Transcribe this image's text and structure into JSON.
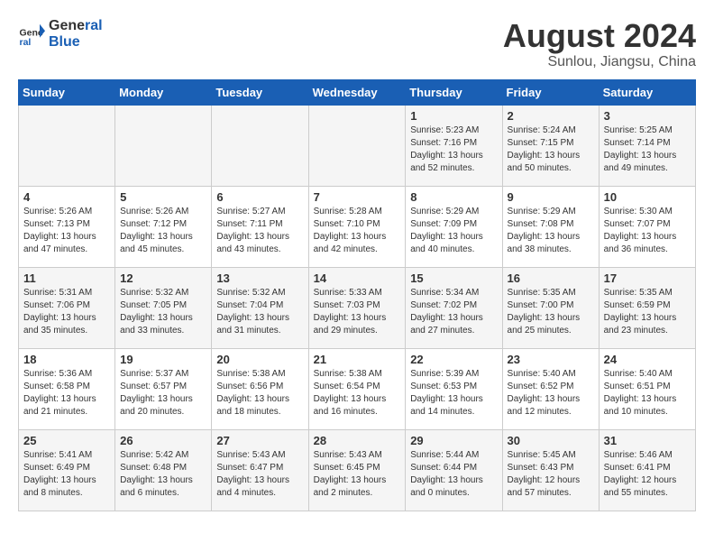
{
  "header": {
    "logo_line1": "General",
    "logo_line2": "Blue",
    "title": "August 2024",
    "subtitle": "Sunlou, Jiangsu, China"
  },
  "days_of_week": [
    "Sunday",
    "Monday",
    "Tuesday",
    "Wednesday",
    "Thursday",
    "Friday",
    "Saturday"
  ],
  "weeks": [
    [
      {
        "day": "",
        "info": ""
      },
      {
        "day": "",
        "info": ""
      },
      {
        "day": "",
        "info": ""
      },
      {
        "day": "",
        "info": ""
      },
      {
        "day": "1",
        "info": "Sunrise: 5:23 AM\nSunset: 7:16 PM\nDaylight: 13 hours\nand 52 minutes."
      },
      {
        "day": "2",
        "info": "Sunrise: 5:24 AM\nSunset: 7:15 PM\nDaylight: 13 hours\nand 50 minutes."
      },
      {
        "day": "3",
        "info": "Sunrise: 5:25 AM\nSunset: 7:14 PM\nDaylight: 13 hours\nand 49 minutes."
      }
    ],
    [
      {
        "day": "4",
        "info": "Sunrise: 5:26 AM\nSunset: 7:13 PM\nDaylight: 13 hours\nand 47 minutes."
      },
      {
        "day": "5",
        "info": "Sunrise: 5:26 AM\nSunset: 7:12 PM\nDaylight: 13 hours\nand 45 minutes."
      },
      {
        "day": "6",
        "info": "Sunrise: 5:27 AM\nSunset: 7:11 PM\nDaylight: 13 hours\nand 43 minutes."
      },
      {
        "day": "7",
        "info": "Sunrise: 5:28 AM\nSunset: 7:10 PM\nDaylight: 13 hours\nand 42 minutes."
      },
      {
        "day": "8",
        "info": "Sunrise: 5:29 AM\nSunset: 7:09 PM\nDaylight: 13 hours\nand 40 minutes."
      },
      {
        "day": "9",
        "info": "Sunrise: 5:29 AM\nSunset: 7:08 PM\nDaylight: 13 hours\nand 38 minutes."
      },
      {
        "day": "10",
        "info": "Sunrise: 5:30 AM\nSunset: 7:07 PM\nDaylight: 13 hours\nand 36 minutes."
      }
    ],
    [
      {
        "day": "11",
        "info": "Sunrise: 5:31 AM\nSunset: 7:06 PM\nDaylight: 13 hours\nand 35 minutes."
      },
      {
        "day": "12",
        "info": "Sunrise: 5:32 AM\nSunset: 7:05 PM\nDaylight: 13 hours\nand 33 minutes."
      },
      {
        "day": "13",
        "info": "Sunrise: 5:32 AM\nSunset: 7:04 PM\nDaylight: 13 hours\nand 31 minutes."
      },
      {
        "day": "14",
        "info": "Sunrise: 5:33 AM\nSunset: 7:03 PM\nDaylight: 13 hours\nand 29 minutes."
      },
      {
        "day": "15",
        "info": "Sunrise: 5:34 AM\nSunset: 7:02 PM\nDaylight: 13 hours\nand 27 minutes."
      },
      {
        "day": "16",
        "info": "Sunrise: 5:35 AM\nSunset: 7:00 PM\nDaylight: 13 hours\nand 25 minutes."
      },
      {
        "day": "17",
        "info": "Sunrise: 5:35 AM\nSunset: 6:59 PM\nDaylight: 13 hours\nand 23 minutes."
      }
    ],
    [
      {
        "day": "18",
        "info": "Sunrise: 5:36 AM\nSunset: 6:58 PM\nDaylight: 13 hours\nand 21 minutes."
      },
      {
        "day": "19",
        "info": "Sunrise: 5:37 AM\nSunset: 6:57 PM\nDaylight: 13 hours\nand 20 minutes."
      },
      {
        "day": "20",
        "info": "Sunrise: 5:38 AM\nSunset: 6:56 PM\nDaylight: 13 hours\nand 18 minutes."
      },
      {
        "day": "21",
        "info": "Sunrise: 5:38 AM\nSunset: 6:54 PM\nDaylight: 13 hours\nand 16 minutes."
      },
      {
        "day": "22",
        "info": "Sunrise: 5:39 AM\nSunset: 6:53 PM\nDaylight: 13 hours\nand 14 minutes."
      },
      {
        "day": "23",
        "info": "Sunrise: 5:40 AM\nSunset: 6:52 PM\nDaylight: 13 hours\nand 12 minutes."
      },
      {
        "day": "24",
        "info": "Sunrise: 5:40 AM\nSunset: 6:51 PM\nDaylight: 13 hours\nand 10 minutes."
      }
    ],
    [
      {
        "day": "25",
        "info": "Sunrise: 5:41 AM\nSunset: 6:49 PM\nDaylight: 13 hours\nand 8 minutes."
      },
      {
        "day": "26",
        "info": "Sunrise: 5:42 AM\nSunset: 6:48 PM\nDaylight: 13 hours\nand 6 minutes."
      },
      {
        "day": "27",
        "info": "Sunrise: 5:43 AM\nSunset: 6:47 PM\nDaylight: 13 hours\nand 4 minutes."
      },
      {
        "day": "28",
        "info": "Sunrise: 5:43 AM\nSunset: 6:45 PM\nDaylight: 13 hours\nand 2 minutes."
      },
      {
        "day": "29",
        "info": "Sunrise: 5:44 AM\nSunset: 6:44 PM\nDaylight: 13 hours\nand 0 minutes."
      },
      {
        "day": "30",
        "info": "Sunrise: 5:45 AM\nSunset: 6:43 PM\nDaylight: 12 hours\nand 57 minutes."
      },
      {
        "day": "31",
        "info": "Sunrise: 5:46 AM\nSunset: 6:41 PM\nDaylight: 12 hours\nand 55 minutes."
      }
    ]
  ]
}
